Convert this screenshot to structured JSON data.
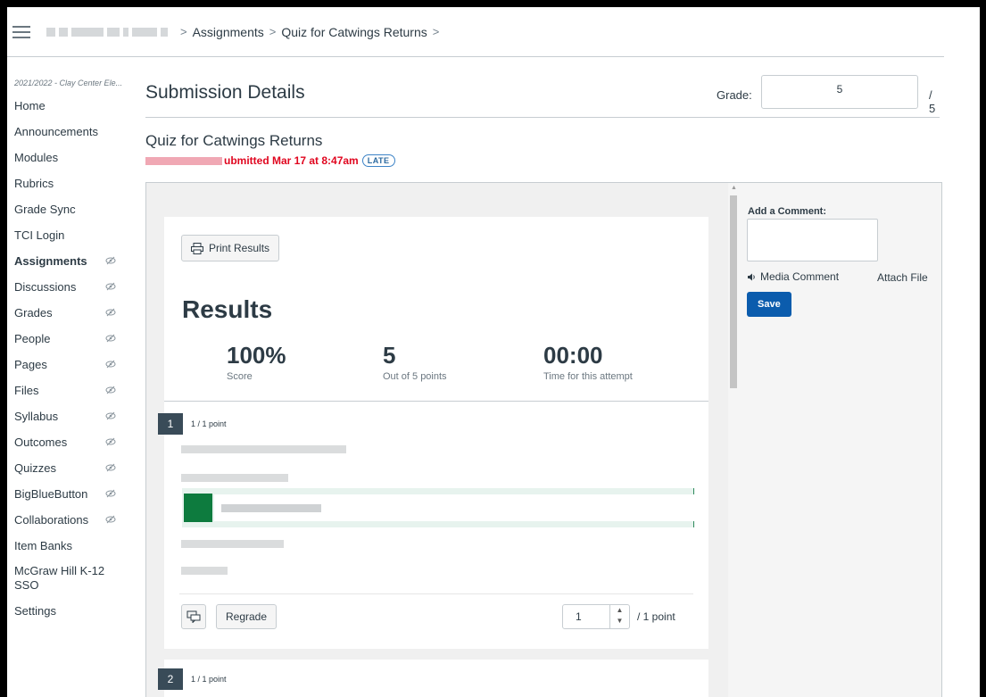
{
  "breadcrumbs": {
    "items": [
      "Assignments",
      "Quiz for Catwings Returns"
    ],
    "separator": ">"
  },
  "sidebar": {
    "term": "2021/2022 - Clay Center Ele...",
    "items": [
      {
        "label": "Home",
        "hidden": false
      },
      {
        "label": "Announcements",
        "hidden": false
      },
      {
        "label": "Modules",
        "hidden": false
      },
      {
        "label": "Rubrics",
        "hidden": false
      },
      {
        "label": "Grade Sync",
        "hidden": false
      },
      {
        "label": "TCI Login",
        "hidden": false
      },
      {
        "label": "Assignments",
        "hidden": true,
        "active": true
      },
      {
        "label": "Discussions",
        "hidden": true
      },
      {
        "label": "Grades",
        "hidden": true
      },
      {
        "label": "People",
        "hidden": true
      },
      {
        "label": "Pages",
        "hidden": true
      },
      {
        "label": "Files",
        "hidden": true
      },
      {
        "label": "Syllabus",
        "hidden": true
      },
      {
        "label": "Outcomes",
        "hidden": true
      },
      {
        "label": "Quizzes",
        "hidden": true
      },
      {
        "label": "BigBlueButton",
        "hidden": true
      },
      {
        "label": "Collaborations",
        "hidden": true
      },
      {
        "label": "Item Banks",
        "hidden": false
      },
      {
        "label": "McGraw Hill K-12 SSO",
        "hidden": false
      },
      {
        "label": "Settings",
        "hidden": false
      }
    ]
  },
  "header": {
    "title": "Submission Details",
    "grade_label": "Grade:",
    "grade_value": "5",
    "grade_outof": "/ 5"
  },
  "submission": {
    "quiz_title": "Quiz for Catwings Returns",
    "submitted_text": "ubmitted Mar 17 at 8:47am",
    "late_badge": "LATE"
  },
  "results": {
    "print_label": "Print Results",
    "title": "Results",
    "stats": [
      {
        "value": "100%",
        "label": "Score"
      },
      {
        "value": "5",
        "label": "Out of 5 points"
      },
      {
        "value": "00:00",
        "label": "Time for this attempt"
      }
    ],
    "questions": [
      {
        "number": "1",
        "points": "1 / 1 point"
      },
      {
        "number": "2",
        "points": "1 / 1 point"
      }
    ],
    "regrade_label": "Regrade",
    "score_value": "1",
    "score_suffix": "/ 1 point"
  },
  "comments": {
    "label": "Add a Comment:",
    "media_label": "Media Comment",
    "attach_label": "Attach File",
    "save_label": "Save"
  },
  "colors": {
    "accent": "#0b5cad",
    "late": "#e0061f",
    "correct": "#0d7b3e"
  }
}
